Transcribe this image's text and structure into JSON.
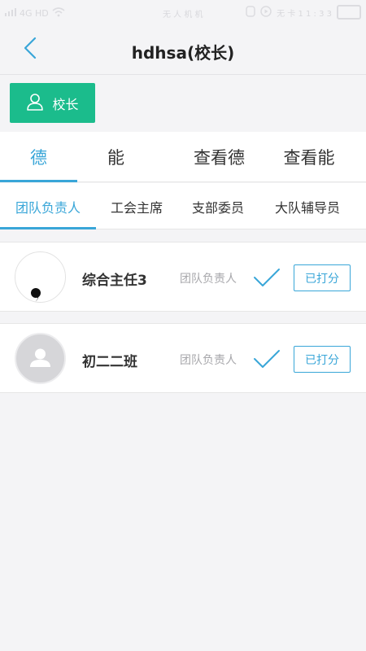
{
  "status_bar": {
    "left_text": "4G HD",
    "center_text": "无 人 机 机",
    "right_text": "无 卡 1 1 : 3 3"
  },
  "nav": {
    "title": "hdhsa(校长)",
    "back_icon": "chevron-left-icon"
  },
  "role_button": {
    "label": "校长",
    "icon": "user-icon",
    "color": "#1bbc8c"
  },
  "main_tabs": [
    {
      "label": "德",
      "active": true
    },
    {
      "label": "能",
      "active": false
    },
    {
      "label": "查看德",
      "active": false
    },
    {
      "label": "查看能",
      "active": false
    }
  ],
  "sub_tabs": [
    {
      "label": "团队负责人",
      "active": true
    },
    {
      "label": "工会主席",
      "active": false
    },
    {
      "label": "支部委员",
      "active": false
    },
    {
      "label": "大队辅导员",
      "active": false
    }
  ],
  "rows": [
    {
      "name": "综合主任3",
      "role": "团队负责人",
      "status_icon": "check-icon",
      "button": "已打分"
    },
    {
      "name": "初二二班",
      "role": "团队负责人",
      "status_icon": "check-icon",
      "button": "已打分"
    }
  ],
  "colors": {
    "accent": "#39a6d8",
    "role_green": "#1bbc8c",
    "background": "#f4f4f6"
  }
}
